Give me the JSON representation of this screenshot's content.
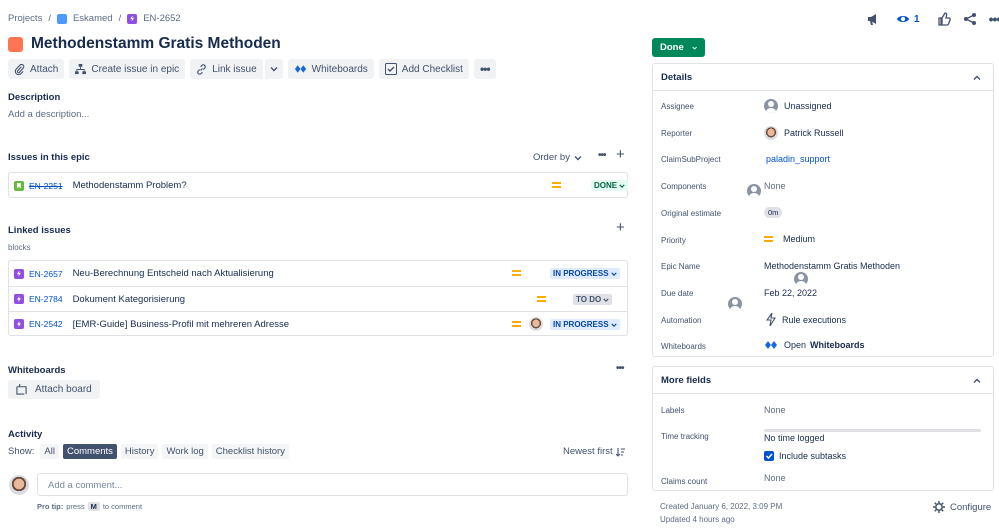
{
  "breadcrumb": {
    "projects": "Projects",
    "sep": "/",
    "project": "Eskamed",
    "issue_key": "EN-2652"
  },
  "header_actions": {
    "watch_count": "1"
  },
  "issue": {
    "title": "Methodenstamm Gratis Methoden"
  },
  "toolbar": {
    "attach": "Attach",
    "create_issue": "Create issue in epic",
    "link_issue": "Link issue",
    "whiteboards": "Whiteboards",
    "add_checklist": "Add Checklist"
  },
  "description": {
    "heading": "Description",
    "placeholder": "Add a description..."
  },
  "epic_issues": {
    "heading": "Issues in this epic",
    "order_by": "Order by",
    "items": [
      {
        "key": "EN-2251",
        "summary": "Methodenstamm Problem?",
        "status": "DONE"
      }
    ]
  },
  "linked": {
    "heading": "Linked issues",
    "relation": "blocks",
    "items": [
      {
        "key": "EN-2657",
        "summary": "Neu-Berechnung Entscheid nach Aktualisierung",
        "status": "IN PROGRESS"
      },
      {
        "key": "EN-2784",
        "summary": "Dokument Kategorisierung",
        "status": "TO DO"
      },
      {
        "key": "EN-2542",
        "summary": "[EMR-Guide] Business-Profil mit mehreren Adresse",
        "status": "IN PROGRESS"
      }
    ]
  },
  "whiteboards": {
    "heading": "Whiteboards",
    "attach": "Attach board"
  },
  "activity": {
    "heading": "Activity",
    "show": "Show:",
    "tabs": [
      "All",
      "Comments",
      "History",
      "Work log",
      "Checklist history"
    ],
    "active_tab": "Comments",
    "sort": "Newest first",
    "comment_placeholder": "Add a comment...",
    "pro_tip_label": "Pro tip:",
    "pro_tip_press": "press",
    "pro_tip_key": "M",
    "pro_tip_rest": "to comment"
  },
  "status_button": "Done",
  "details": {
    "heading": "Details",
    "fields": {
      "assignee": {
        "label": "Assignee",
        "value": "Unassigned"
      },
      "reporter": {
        "label": "Reporter",
        "value": "Patrick Russell"
      },
      "claim": {
        "label": "ClaimSubProject",
        "value": "paladin_support"
      },
      "components": {
        "label": "Components",
        "value": "None"
      },
      "estimate": {
        "label": "Original estimate",
        "value": "0m"
      },
      "priority": {
        "label": "Priority",
        "value": "Medium"
      },
      "epic_name": {
        "label": "Epic Name",
        "value": "Methodenstamm Gratis Methoden"
      },
      "due": {
        "label": "Due date",
        "value": "Feb 22, 2022"
      },
      "automation": {
        "label": "Automation",
        "value": "Rule executions"
      },
      "whiteboards": {
        "label": "Whiteboards",
        "value_prefix": "Open",
        "value_bold": "Whiteboards"
      }
    }
  },
  "more": {
    "heading": "More fields",
    "labels": {
      "label": "Labels",
      "value": "None"
    },
    "time": {
      "label": "Time tracking",
      "value": "No time logged",
      "checkbox": "Include subtasks"
    },
    "claims": {
      "label": "Claims count",
      "value": "None"
    }
  },
  "footer": {
    "created": "Created January 6, 2022, 3:09 PM",
    "updated": "Updated 4 hours ago",
    "configure": "Configure"
  },
  "colors": {
    "epic_orange": "#ff7452",
    "done_green": "#00875a",
    "link_blue": "#0052cc",
    "priority": "#ffab00"
  }
}
